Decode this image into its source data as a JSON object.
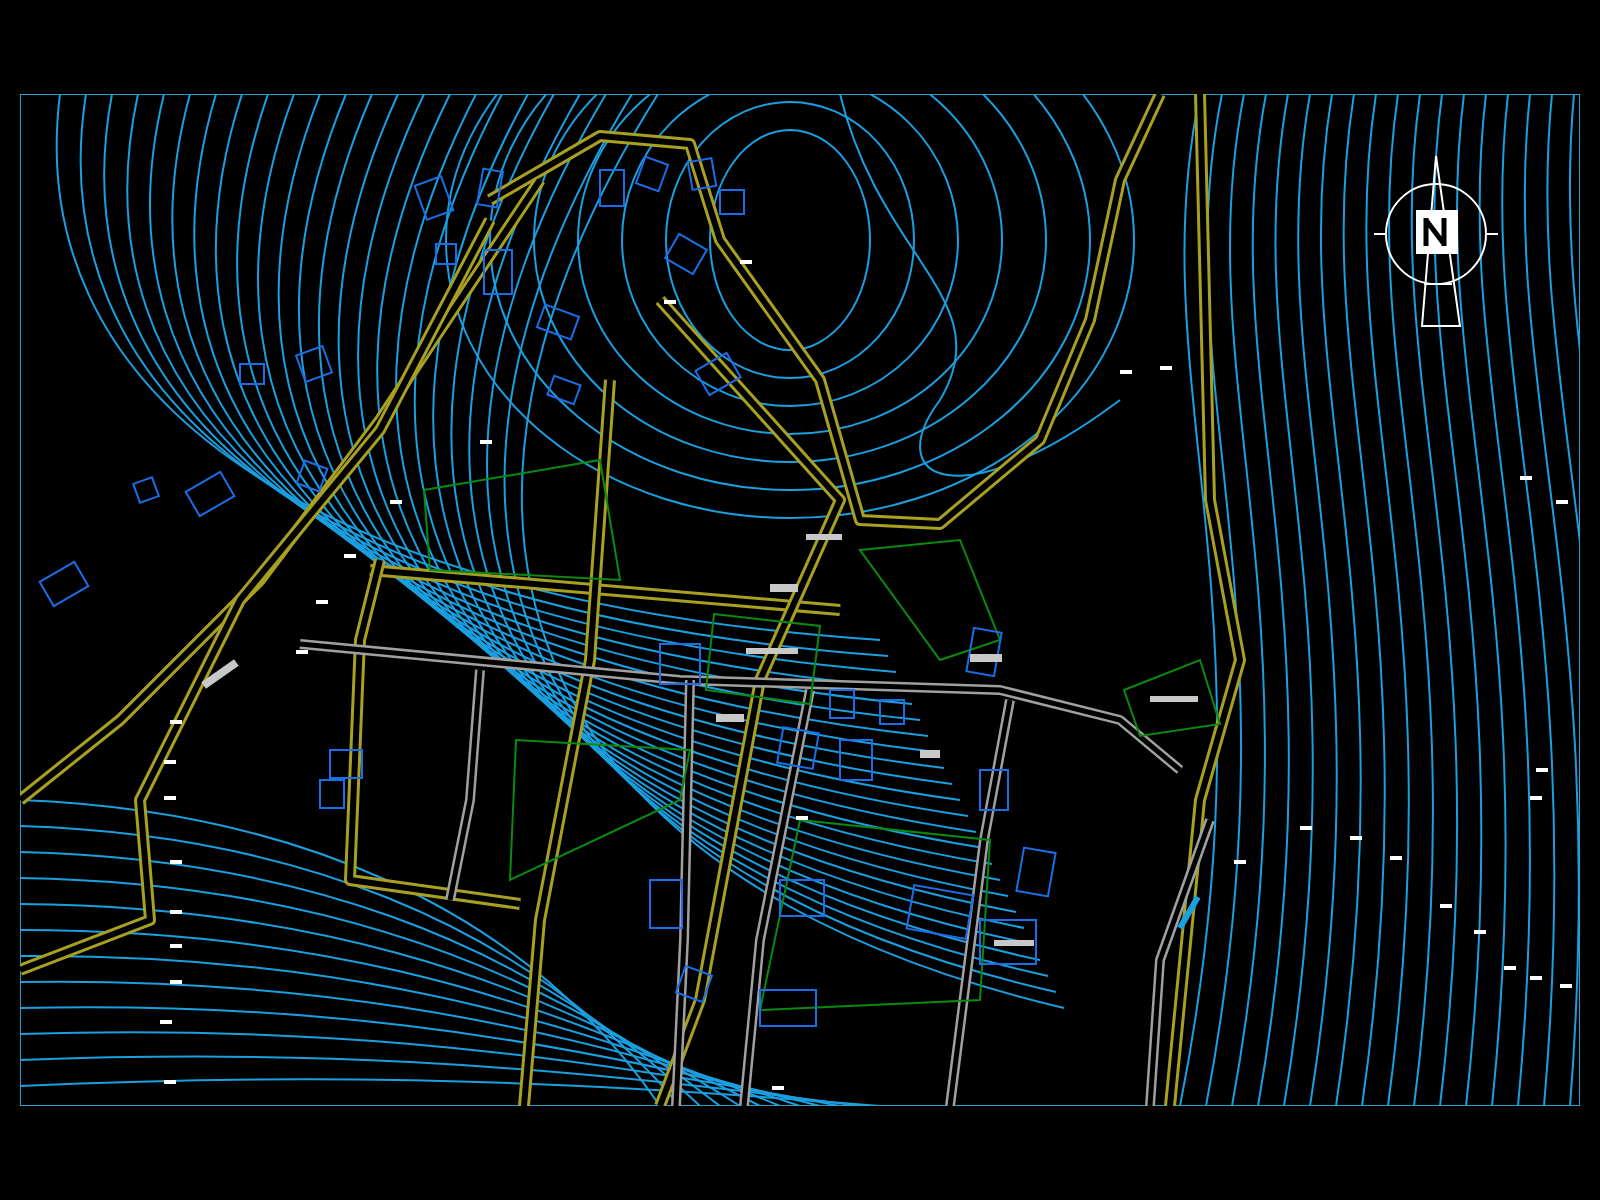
{
  "plan": {
    "north_arrow": true
  }
}
